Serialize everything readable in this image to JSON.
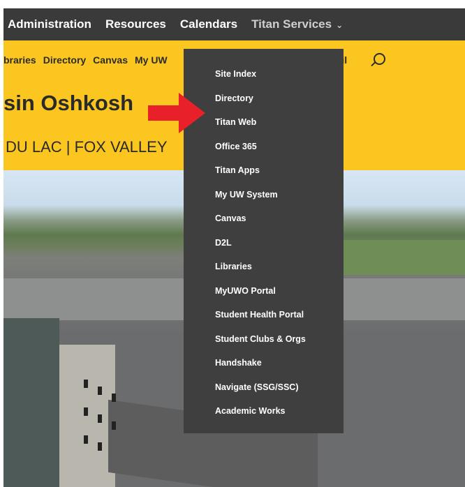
{
  "topnav": {
    "items": [
      "Administration",
      "Resources",
      "Calendars"
    ],
    "active": "Titan Services",
    "active_chevron": "⌄"
  },
  "quicklinks": {
    "left": [
      "braries",
      "Directory",
      "Canvas",
      "My UW"
    ],
    "right": "ncil",
    "search_icon": "search-icon"
  },
  "header": {
    "title": "sin Oshkosh",
    "campuses": "DU LAC | FOX VALLEY"
  },
  "dropdown": {
    "items": [
      "Site Index",
      "Directory",
      "Titan Web",
      "Office 365",
      "Titan Apps",
      "My UW System",
      "Canvas",
      "D2L",
      "Libraries",
      "MyUWO Portal",
      "Student Health Portal",
      "Student Clubs & Orgs",
      "Handshake",
      "Navigate (SSG/SSC)",
      "Academic Works"
    ]
  },
  "colors": {
    "nav_bg": "#3a3a3a",
    "brand_yellow": "#fcc620",
    "dropdown_bg": "#3f3f3f",
    "annotation_arrow": "#e8202a"
  }
}
